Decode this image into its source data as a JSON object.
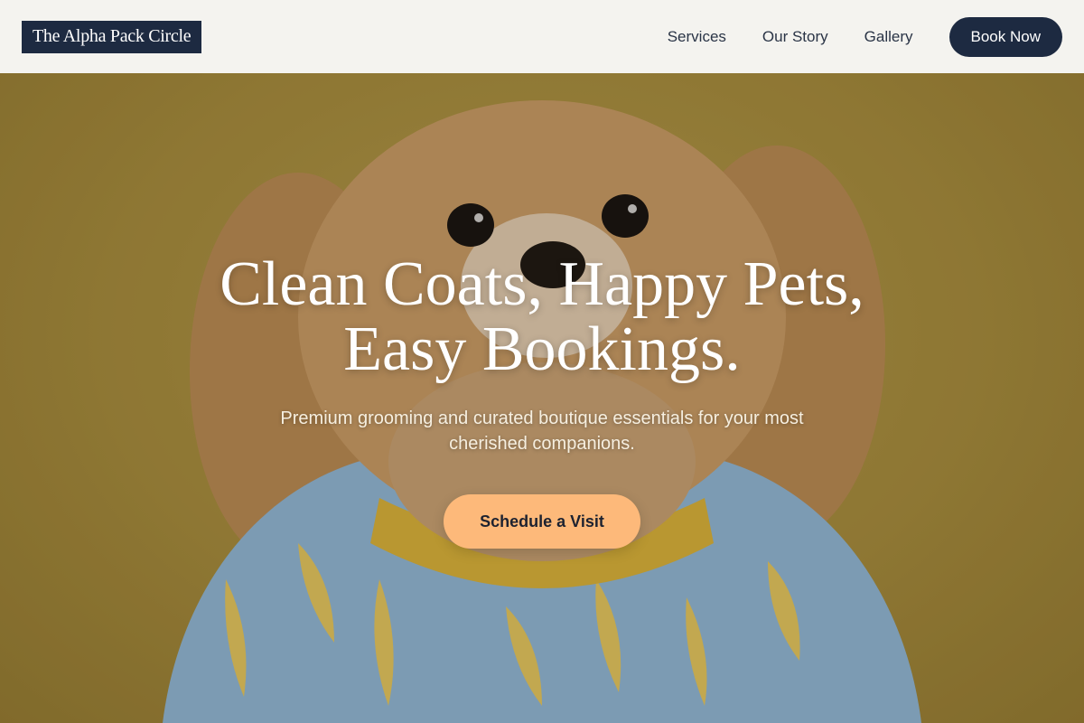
{
  "header": {
    "logo_text": "The Alpha Pack Circle",
    "nav": [
      {
        "label": "Services"
      },
      {
        "label": "Our Story"
      },
      {
        "label": "Gallery"
      }
    ],
    "book_label": "Book Now"
  },
  "hero": {
    "title_line1": "Clean Coats, Happy Pets,",
    "title_line2": "Easy Bookings.",
    "subtitle": "Premium grooming and curated boutique essentials for your most cherished companions.",
    "cta_label": "Schedule a Visit",
    "image_description": "fluffy dog in banana-print shirt"
  },
  "colors": {
    "navy": "#1d2a41",
    "header_bg": "#f4f3ef",
    "cta": "#fdb97a",
    "backdrop": "#a68c3d"
  }
}
